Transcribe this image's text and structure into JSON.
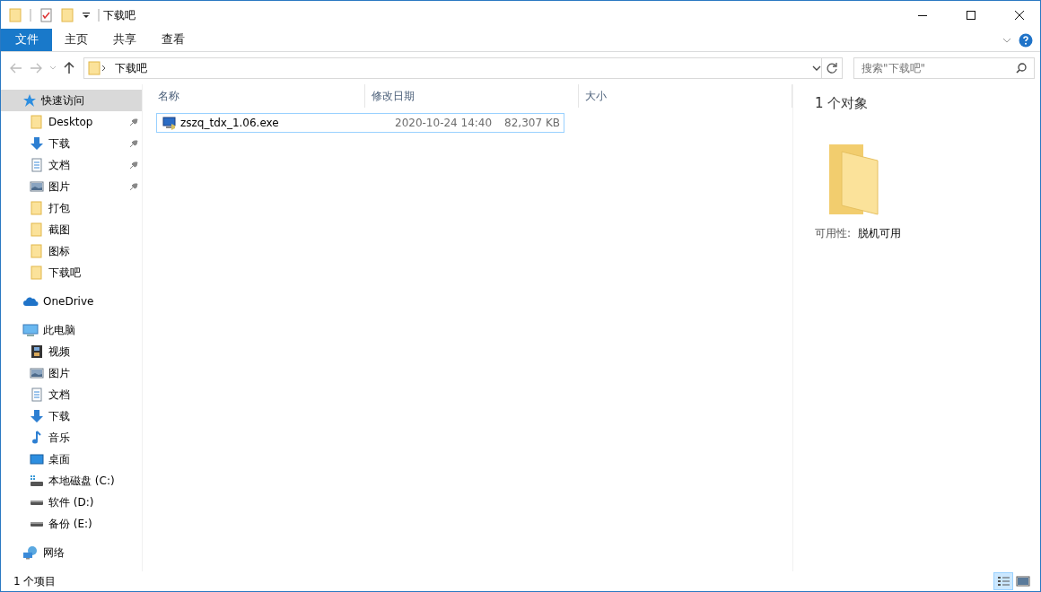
{
  "window": {
    "title": "下载吧"
  },
  "ribbon_tabs": [
    {
      "label": "文件",
      "selected": true
    },
    {
      "label": "主页",
      "selected": false
    },
    {
      "label": "共享",
      "selected": false
    },
    {
      "label": "查看",
      "selected": false
    }
  ],
  "address": {
    "path": [
      "下载吧"
    ]
  },
  "search": {
    "placeholder": "搜索\"下载吧\""
  },
  "sidebar": {
    "items": [
      {
        "label": "快速访问",
        "kind": "star",
        "selected": true,
        "children": [
          {
            "label": "Desktop",
            "kind": "folder",
            "pinned": true
          },
          {
            "label": "下载",
            "kind": "download",
            "pinned": true
          },
          {
            "label": "文档",
            "kind": "document",
            "pinned": true
          },
          {
            "label": "图片",
            "kind": "picture",
            "pinned": true
          },
          {
            "label": "打包",
            "kind": "folder",
            "pinned": false
          },
          {
            "label": "截图",
            "kind": "folder",
            "pinned": false
          },
          {
            "label": "图标",
            "kind": "folder",
            "pinned": false
          },
          {
            "label": "下载吧",
            "kind": "folder",
            "pinned": false
          }
        ]
      },
      {
        "label": "OneDrive",
        "kind": "cloud",
        "selected": false
      },
      {
        "label": "此电脑",
        "kind": "pc",
        "selected": false,
        "children": [
          {
            "label": "视频",
            "kind": "video",
            "pinned": false
          },
          {
            "label": "图片",
            "kind": "picture",
            "pinned": false
          },
          {
            "label": "文档",
            "kind": "document",
            "pinned": false
          },
          {
            "label": "下载",
            "kind": "download",
            "pinned": false
          },
          {
            "label": "音乐",
            "kind": "music",
            "pinned": false
          },
          {
            "label": "桌面",
            "kind": "desktop",
            "pinned": false
          },
          {
            "label": "本地磁盘 (C:)",
            "kind": "system-drive",
            "pinned": false
          },
          {
            "label": "软件 (D:)",
            "kind": "drive",
            "pinned": false
          },
          {
            "label": "备份 (E:)",
            "kind": "drive",
            "pinned": false
          }
        ]
      },
      {
        "label": "网络",
        "kind": "network",
        "selected": false
      }
    ]
  },
  "table": {
    "columns": [
      "名称",
      "修改日期",
      "大小"
    ],
    "rows": [
      {
        "name": "zszq_tdx_1.06.exe",
        "modified": "2020-10-24 14:40",
        "size": "82,307 KB",
        "selected": true
      }
    ]
  },
  "details_pane": {
    "title": "1 个对象",
    "availability_label": "可用性:",
    "availability_value": "脱机可用"
  },
  "status_bar": {
    "text": "1 个项目",
    "views": [
      {
        "kind": "details",
        "selected": true
      },
      {
        "kind": "large-icons",
        "selected": false
      }
    ]
  }
}
